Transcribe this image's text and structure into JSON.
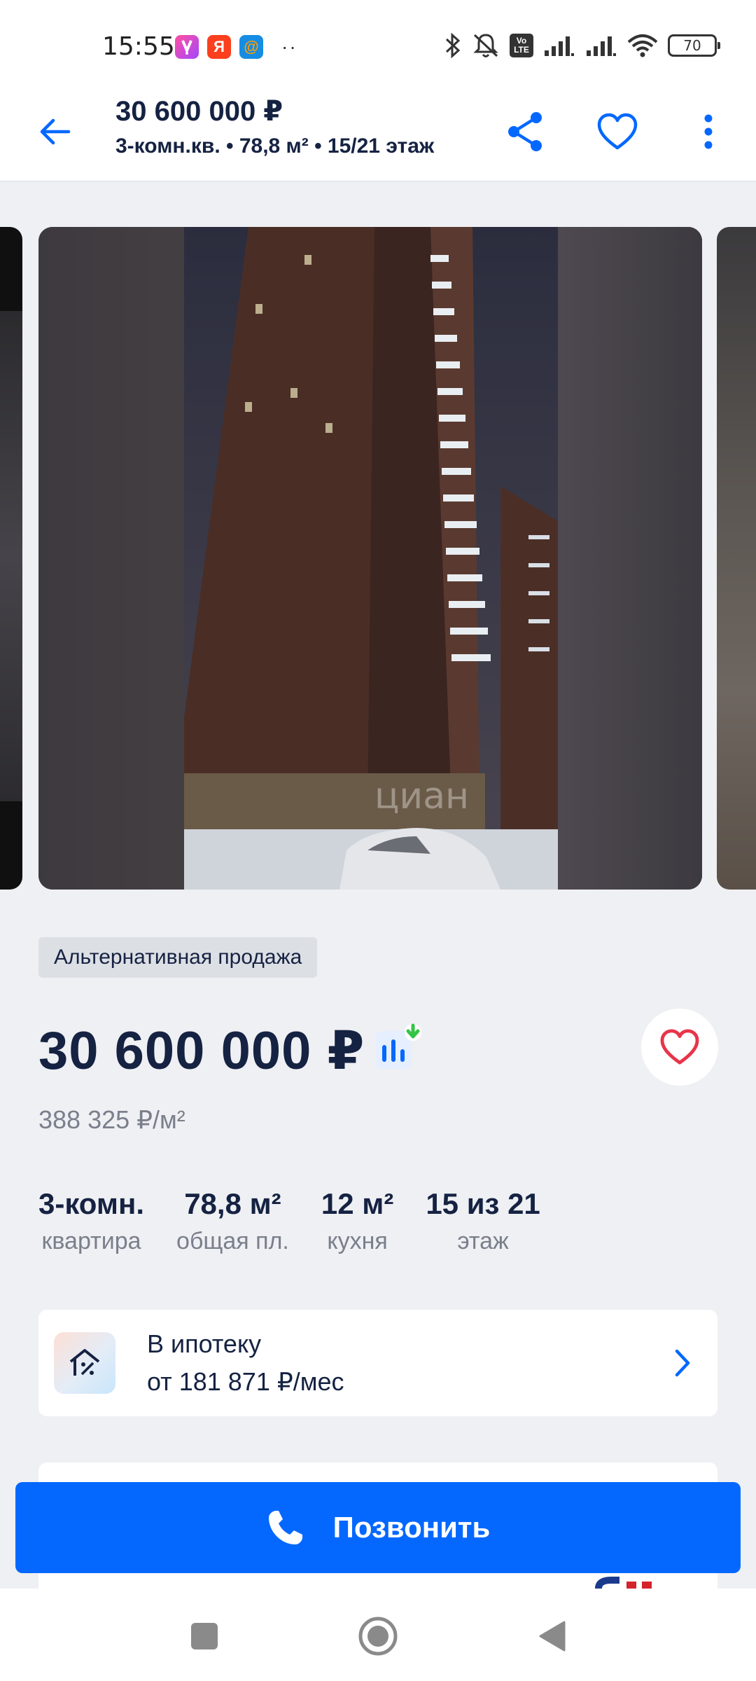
{
  "status_bar": {
    "time": "15:55",
    "apps": [
      "vk-app-icon",
      "yandex-app-icon",
      "mail-app-icon"
    ],
    "yandex_letter": "Я",
    "mail_letter": "@",
    "more": "··",
    "battery": "70",
    "volte": "Vo LTE"
  },
  "header": {
    "title": "30 600 000 ₽",
    "subtitle": "3-комн.кв. • 78,8 м² • 15/21 этаж",
    "accent": "#0468ff"
  },
  "gallery": {
    "watermark": "циан"
  },
  "listing": {
    "tag": "Альтернативная продажа",
    "price": "30 600 000 ₽",
    "price_per_m": "388 325 ₽/м²",
    "facts": [
      {
        "value": "3-комн.",
        "label": "квартира"
      },
      {
        "value": "78,8 м²",
        "label": "общая пл."
      },
      {
        "value": "12 м²",
        "label": "кухня"
      },
      {
        "value": "15 из 21",
        "label": "этаж"
      }
    ],
    "mortgage": {
      "title": "В ипотеку",
      "subtitle": "от 181 871 ₽/мес"
    }
  },
  "call_button": {
    "label": "Позвонить"
  },
  "colors": {
    "primary": "#0468ff",
    "text": "#152242",
    "muted": "#7a7f8c",
    "favorite": "#e8344a",
    "price_drop": "#33c445"
  }
}
